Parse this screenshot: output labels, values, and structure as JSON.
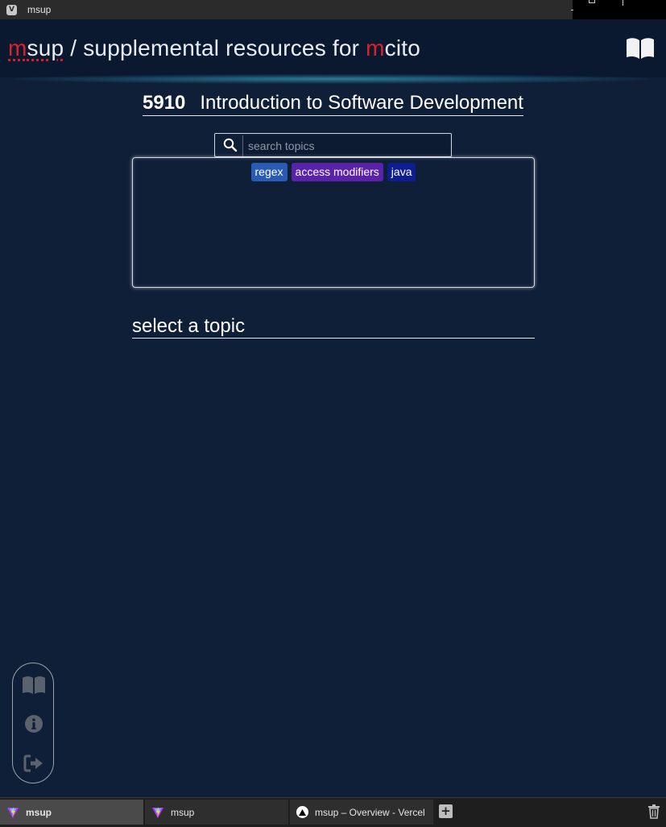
{
  "window": {
    "title": "msup"
  },
  "header": {
    "brand_m": "m",
    "brand_sup": "sup",
    "separator": " / ",
    "subtitle_main": "supplemental resources for ",
    "subtitle_m": "m",
    "subtitle_end": "cito",
    "book_icon": "book-open-icon"
  },
  "course": {
    "number": "5910",
    "name": "Introduction to Software Development"
  },
  "search": {
    "placeholder": "search topics",
    "value": "",
    "icon": "search-icon"
  },
  "topics": {
    "tags": [
      {
        "label": "regex",
        "color": "#2a5bb4"
      },
      {
        "label": "access modifiers",
        "color": "#5a22a8"
      },
      {
        "label": "java",
        "color": "#0f1e8e"
      }
    ]
  },
  "content": {
    "heading": "select a topic"
  },
  "sidebar": {
    "buttons": [
      {
        "icon": "book-open-icon"
      },
      {
        "icon": "info-icon"
      },
      {
        "icon": "sign-out-icon"
      }
    ]
  },
  "taskbar": {
    "tabs": [
      {
        "label": "msup",
        "active": true
      },
      {
        "label": "msup",
        "active": false
      },
      {
        "label": "msup – Overview - Vercel",
        "active": false
      }
    ],
    "new_tab_label": "+"
  },
  "colors": {
    "background": "#0f1f38",
    "header": "#0b1930",
    "brand_red": "#e0202a"
  }
}
